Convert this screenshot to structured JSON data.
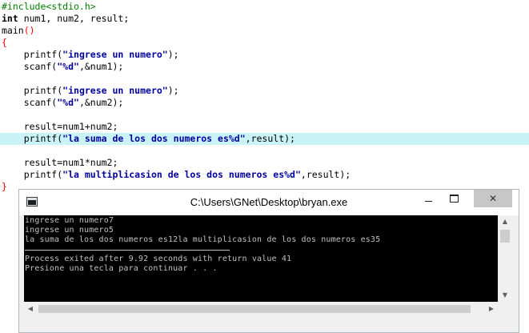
{
  "editor": {
    "lines": {
      "include": "#include<stdio.h>",
      "decl_kw": "int",
      "decl_rest": " num1, num2, result;",
      "main_name": "main",
      "main_parens": "()",
      "open_brace": "{",
      "printf1_fn": "    printf(",
      "printf1_str": "\"ingrese un numero\"",
      "printf1_end": ");",
      "scanf1_fn": "    scanf(",
      "scanf1_fmt": "\"%d\"",
      "scanf1_end": ",&num1);",
      "printf2_fn": "    printf(",
      "printf2_str": "\"ingrese un numero\"",
      "printf2_end": ");",
      "scanf2_fn": "    scanf(",
      "scanf2_fmt": "\"%d\"",
      "scanf2_end": ",&num2);",
      "sum_stmt": "    result=num1+num2;",
      "printf3_fn": "    printf(",
      "printf3_str": "\"la suma de los dos numeros es%d\"",
      "printf3_end": ",result);",
      "mul_stmt": "    result=num1*num2;",
      "printf4_fn": "    printf(",
      "printf4_str": "\"la multiplicasion de los dos numeros es%d\"",
      "printf4_end": ",result);",
      "close_brace": "}"
    },
    "highlight_color": "#c9f3f7"
  },
  "console": {
    "title": "C:\\Users\\GNet\\Desktop\\bryan.exe",
    "icons": {
      "app": "console-app-icon",
      "minimize": "minimize-icon",
      "maximize": "maximize-icon",
      "close": "close-icon"
    },
    "close_glyph": "✕",
    "output": [
      "ingrese un numero7",
      "ingrese un numero5",
      "la suma de los dos numeros es12la multiplicasion de los dos numeros es35",
      "Process exited after 9.92 seconds with return value 41",
      "Presione una tecla para continuar . . ."
    ],
    "scroll_arrows": {
      "up": "▲",
      "down": "▼",
      "left": "◀",
      "right": "▶"
    }
  }
}
